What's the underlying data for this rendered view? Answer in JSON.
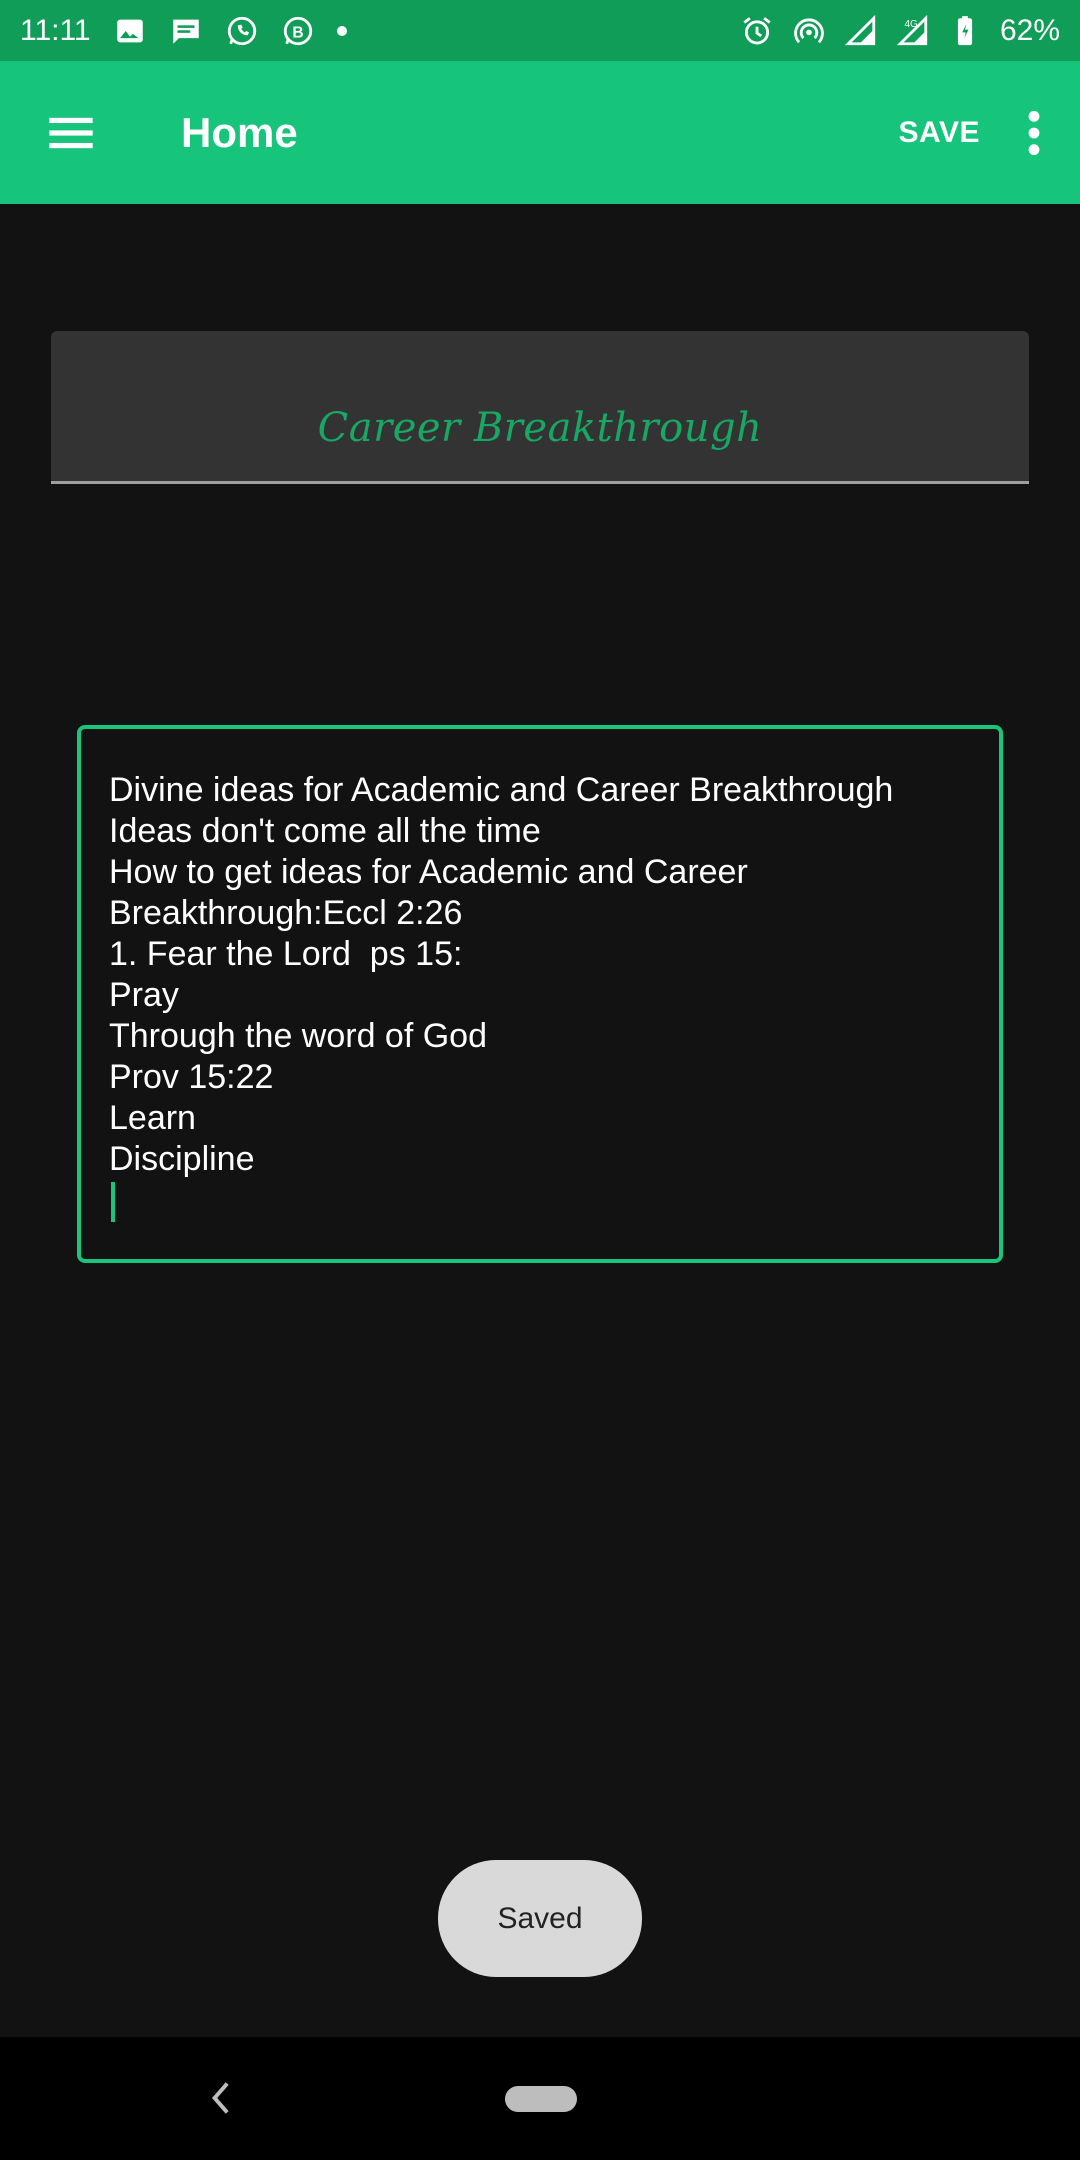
{
  "status_bar": {
    "time": "11:11",
    "battery": "62%",
    "network": "4G",
    "icons_left": [
      "image-icon",
      "message-icon",
      "whatsapp-icon",
      "whatsapp-business-icon",
      "notification-dot-icon"
    ],
    "icons_right": [
      "alarm-icon",
      "hotspot-icon",
      "signal-icon",
      "signal-4g-icon",
      "battery-charging-icon"
    ]
  },
  "app_bar": {
    "title": "Home",
    "save_label": "SAVE",
    "menu_icon": "hamburger-menu-icon",
    "more_icon": "more-vert-icon"
  },
  "note": {
    "title": "Career Breakthrough",
    "body_lines": [
      "Divine ideas for Academic and Career Breakthrough",
      "Ideas don't come all the time",
      "How to get ideas for Academic and Career",
      "Breakthrough:Eccl 2:26",
      "1. Fear the Lord  ps 15:",
      "Pray",
      "Through the word of God",
      "Prov 15:22",
      "Learn",
      "Discipline"
    ]
  },
  "toast": {
    "text": "Saved"
  },
  "colors": {
    "status_bar": "#0f9d58",
    "app_bar": "#17c47b",
    "accent": "#1bc47b",
    "background": "#121212",
    "title_field": "#333333"
  }
}
